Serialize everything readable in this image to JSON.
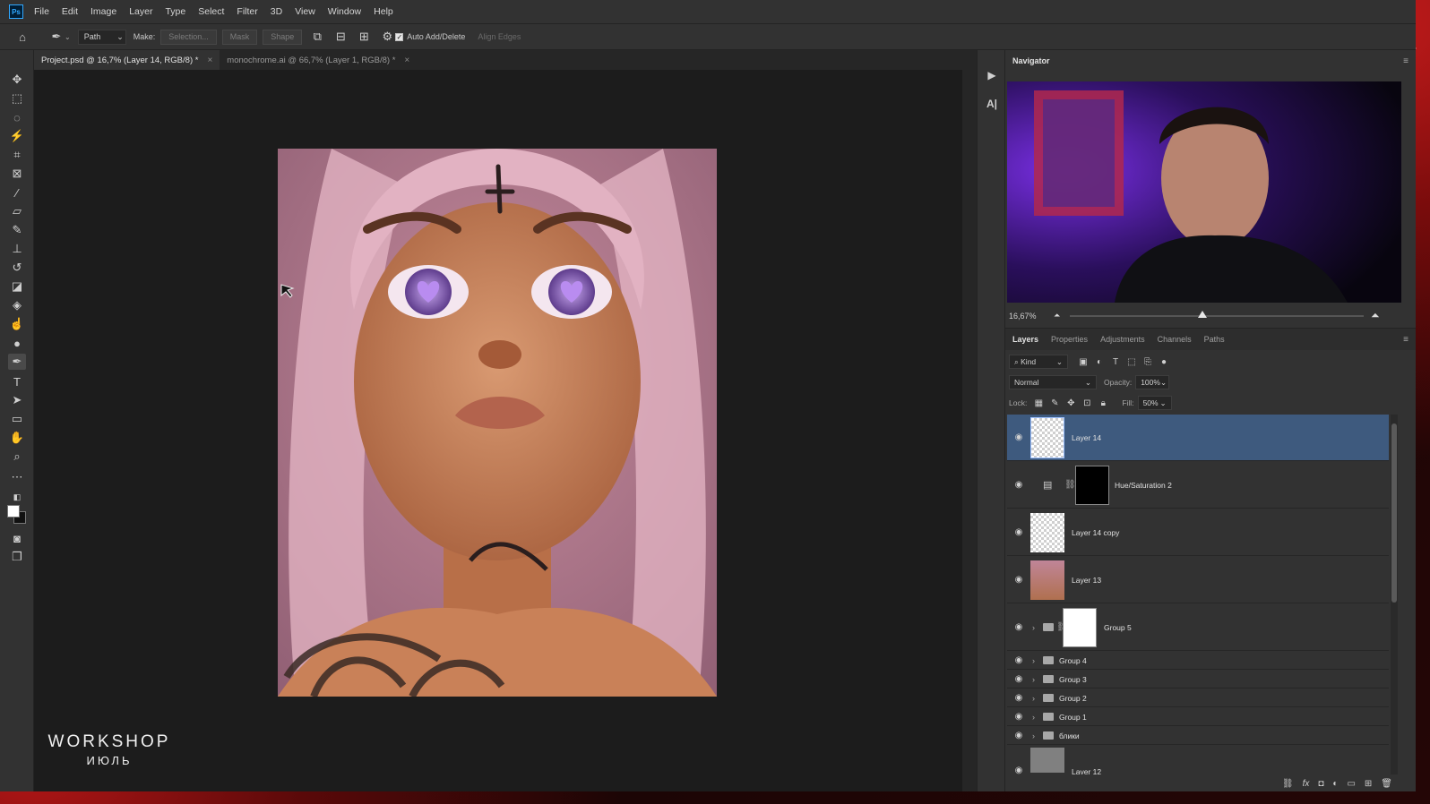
{
  "app": {
    "logo": "Ps"
  },
  "menu": [
    "File",
    "Edit",
    "Image",
    "Layer",
    "Type",
    "Select",
    "Filter",
    "3D",
    "View",
    "Window",
    "Help"
  ],
  "options": {
    "mode": "Path",
    "make_label": "Make:",
    "selection_btn": "Selection...",
    "mask_btn": "Mask",
    "shape_btn": "Shape",
    "auto_add_delete": "Auto Add/Delete",
    "align_edges": "Align Edges"
  },
  "doc_tabs": [
    {
      "label": "Project.psd @ 16,7% (Layer 14, RGB/8) *",
      "close": "×"
    },
    {
      "label": "monochrome.ai @ 66,7% (Layer 1, RGB/8) *",
      "close": "×"
    }
  ],
  "watermark": {
    "title": "WORKSHOP",
    "subtitle": "ИЮЛЬ"
  },
  "navigator": {
    "title": "Navigator",
    "zoom": "16,67%",
    "zoom_level": 0.45
  },
  "layers_panel": {
    "tabs": [
      "Layers",
      "Properties",
      "Adjustments",
      "Channels",
      "Paths"
    ],
    "kind_label": "Kind",
    "blend_mode": "Normal",
    "opacity_label": "Opacity:",
    "opacity_value": "100%",
    "lock_label": "Lock:",
    "fill_label": "Fill:",
    "fill_value": "50%",
    "layers": [
      {
        "name": "Layer 14"
      },
      {
        "name": "Hue/Saturation 2"
      },
      {
        "name": "Layer 14 copy"
      },
      {
        "name": "Layer 13"
      },
      {
        "name": "Group 5"
      },
      {
        "name": "Group 4"
      },
      {
        "name": "Group 3"
      },
      {
        "name": "Group 2"
      },
      {
        "name": "Group 1"
      },
      {
        "name": "блики"
      },
      {
        "name": "Layer 12"
      }
    ]
  },
  "icons": {
    "eye": "eye-icon",
    "folder": "folder-icon",
    "accent_selected": "#3e5a7e",
    "app_blue": "#31a8ff"
  }
}
